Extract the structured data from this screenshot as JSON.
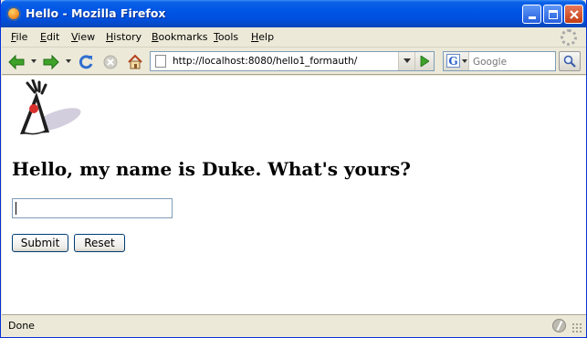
{
  "window": {
    "title": "Hello - Mozilla Firefox"
  },
  "menubar": {
    "items": [
      "File",
      "Edit",
      "View",
      "History",
      "Bookmarks",
      "Tools",
      "Help"
    ]
  },
  "navbar": {
    "url": "http://localhost:8080/hello1_formauth/",
    "search_placeholder": "Google"
  },
  "page": {
    "heading": "Hello, my name is Duke. What's yours?",
    "name_input_value": "",
    "submit_label": "Submit",
    "reset_label": "Reset"
  },
  "statusbar": {
    "text": "Done"
  },
  "icons": {
    "titlebar": "firefox-icon",
    "back": "back-arrow-icon",
    "forward": "forward-arrow-icon",
    "reload": "reload-icon",
    "stop": "stop-icon",
    "home": "home-icon",
    "go": "go-arrow-icon",
    "search": "magnifier-icon"
  },
  "colors": {
    "titlebar": "#0055e5",
    "chrome": "#ece9d8",
    "nav_green": "#3fa32a",
    "duke_red": "#d8312c"
  }
}
